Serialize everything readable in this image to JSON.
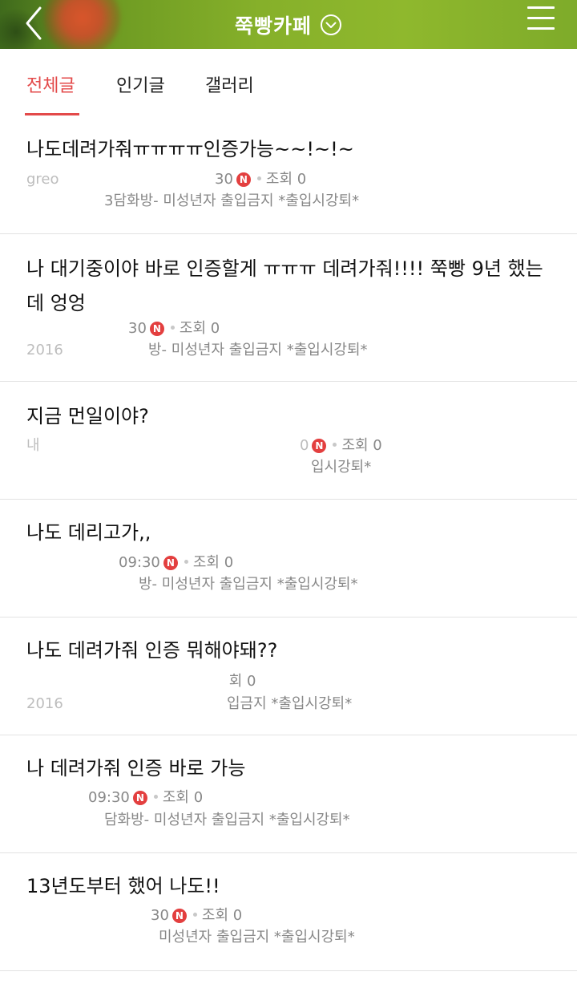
{
  "header": {
    "title": "쭉빵카페",
    "icons": {
      "back": "back-chevron-icon",
      "title_dropdown": "circle-chevron-down-icon",
      "menu": "hamburger-menu-icon"
    }
  },
  "tabs": [
    {
      "label": "전체글",
      "active": true
    },
    {
      "label": "인기글",
      "active": false
    },
    {
      "label": "갤러리",
      "active": false
    }
  ],
  "colors": {
    "accent": "#e34a4a",
    "header_green": "#86b02a",
    "badge": "#e33f3f"
  },
  "posts": [
    {
      "title": "나도데려가줘ㅠㅠㅠㅠ인증가능~~!~!~",
      "author_fragment": "greo",
      "time_fragment": "30",
      "views": "조회 0",
      "board_fragment": "3담화방- 미성년자 출입금지 *출입시강퇴*"
    },
    {
      "title": "나 대기중이야 바로 인증할게 ㅠㅠㅠ 데려가줘!!!! 쭉빵 9년 했는데 엉엉",
      "author_fragment": "",
      "time_fragment": "30",
      "views": "조회 0",
      "board_fragment_left": "2016",
      "board_fragment": "방- 미성년자 출입금지 *출입시강퇴*"
    },
    {
      "title": "지금 먼일이야?",
      "author_fragment": "내",
      "time_fragment": "0",
      "views": "조회 0",
      "board_fragment": "입시강퇴*"
    },
    {
      "title": "나도 데리고가,,",
      "author_fragment": "",
      "time_fragment": "09:30",
      "views": "조회 0",
      "board_fragment": "방- 미성년자 출입금지 *출입시강퇴*"
    },
    {
      "title": "나도 데려가줘 인증 뭐해야돼??",
      "author_fragment": "",
      "time_fragment": "",
      "views": "회 0",
      "board_fragment_left": "2016",
      "board_fragment": "입금지 *출입시강퇴*"
    },
    {
      "title": "나 데려가줘 인증 바로 가능",
      "author_fragment": "",
      "time_fragment": "09:30",
      "views": "조회 0",
      "board_fragment": "담화방- 미성년자 출입금지 *출입시강퇴*"
    },
    {
      "title": "13년도부터 했어 나도!!",
      "author_fragment": "",
      "time_fragment": "30",
      "views": "조회 0",
      "board_fragment": "미성년자 출입금지 *출입시강퇴*"
    }
  ],
  "badge_letter": "N"
}
